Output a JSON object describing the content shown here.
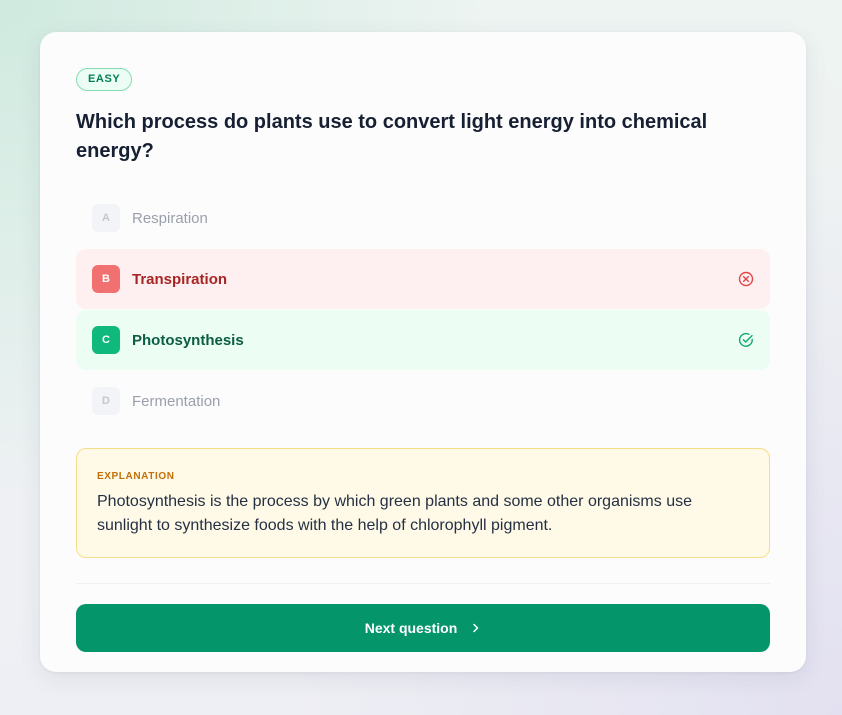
{
  "quiz": {
    "difficulty": "EASY",
    "question": "Which process do plants use to convert light energy into chemical energy?",
    "options": [
      {
        "letter": "A",
        "label": "Respiration",
        "state": "neutral"
      },
      {
        "letter": "B",
        "label": "Transpiration",
        "state": "incorrect",
        "icon": "x-circle-icon"
      },
      {
        "letter": "C",
        "label": "Photosynthesis",
        "state": "correct",
        "icon": "check-circle-icon"
      },
      {
        "letter": "D",
        "label": "Fermentation",
        "state": "neutral"
      }
    ],
    "explanation": {
      "title": "EXPLANATION",
      "text": "Photosynthesis is the process by which green plants and some other organisms use sunlight to synthesize foods with the help of chlorophyll pigment."
    },
    "next_button": {
      "label": "Next question",
      "icon": "chevron-right-icon"
    }
  },
  "colors": {
    "accent": "#05956a",
    "correct": "#0fb87d",
    "incorrect": "#f0716f",
    "explanation_bg": "#fefae7"
  }
}
